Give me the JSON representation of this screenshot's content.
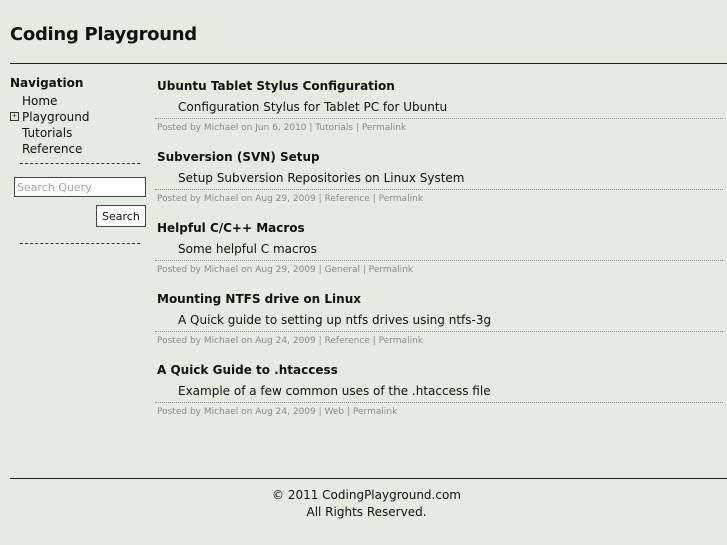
{
  "site": {
    "title": "Coding Playground"
  },
  "sidebar": {
    "heading": "Navigation",
    "items": [
      {
        "label": "Home",
        "expandable": false
      },
      {
        "label": "Playground",
        "expandable": true,
        "expander_glyph": "+"
      },
      {
        "label": "Tutorials",
        "expandable": false
      },
      {
        "label": "Reference",
        "expandable": false
      }
    ],
    "search": {
      "placeholder": "Search Query",
      "value": "",
      "button_label": "Search"
    }
  },
  "posts": [
    {
      "title": "Ubuntu Tablet Stylus Configuration",
      "summary": "Configuration Stylus for Tablet PC for Ubuntu",
      "meta_prefix": "Posted by Michael on Jun 6, 2010 | ",
      "category": "Tutorials",
      "sep": " | ",
      "permalink": "Permalink"
    },
    {
      "title": "Subversion (SVN) Setup",
      "summary": "Setup Subversion Repositories on Linux System",
      "meta_prefix": "Posted by Michael on Aug 29, 2009 | ",
      "category": "Reference",
      "sep": " | ",
      "permalink": "Permalink"
    },
    {
      "title": "Helpful C/C++ Macros",
      "summary": "Some helpful C macros",
      "meta_prefix": "Posted by Michael on Aug 29, 2009 | ",
      "category": "General",
      "sep": " | ",
      "permalink": "Permalink"
    },
    {
      "title": "Mounting NTFS drive on Linux",
      "summary": "A Quick guide to setting up ntfs drives using ntfs-3g",
      "meta_prefix": "Posted by Michael on Aug 24, 2009 | ",
      "category": "Reference",
      "sep": " | ",
      "permalink": "Permalink"
    },
    {
      "title": "A Quick Guide to .htaccess",
      "summary": "Example of a few common uses of the .htaccess file",
      "meta_prefix": "Posted by Michael on Aug 24, 2009 | ",
      "category": "Web",
      "sep": " | ",
      "permalink": "Permalink"
    }
  ],
  "footer": {
    "copyright": "© 2011 CodingPlayground.com",
    "rights": "All Rights Reserved."
  },
  "colors": {
    "background": "#e3ecdf",
    "text": "#111111",
    "meta_text": "#8a8f89"
  }
}
